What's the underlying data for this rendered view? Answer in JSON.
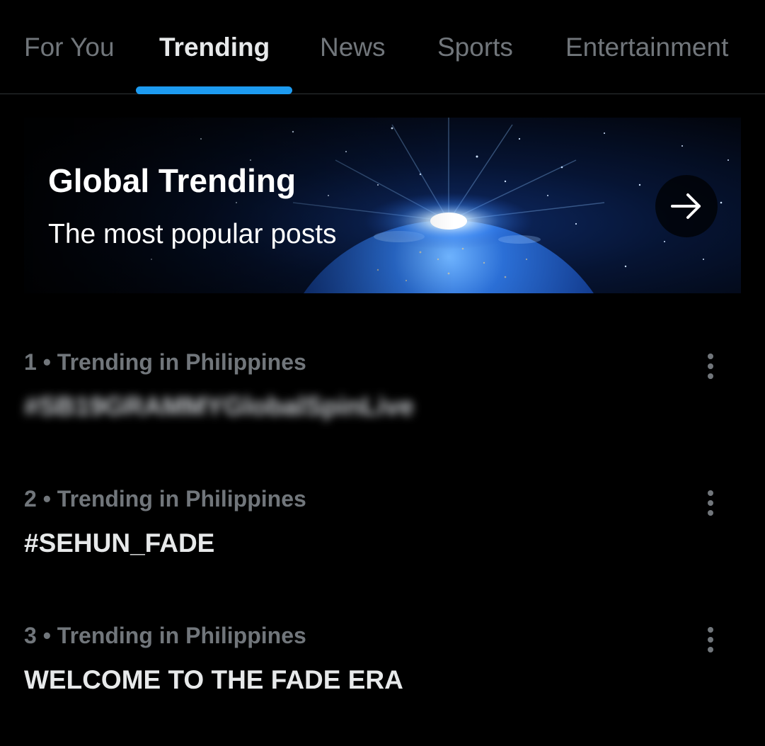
{
  "tabs": [
    {
      "label": "For You"
    },
    {
      "label": "Trending"
    },
    {
      "label": "News"
    },
    {
      "label": "Sports"
    },
    {
      "label": "Entertainment"
    }
  ],
  "active_tab": "Trending",
  "banner": {
    "title": "Global Trending",
    "subtitle": "The most popular posts",
    "arrow_icon": "arrow-right-icon"
  },
  "trends": [
    {
      "meta": "1 • Trending in Philippines",
      "name": "#SB19GRAMMYGlobalSpinLive",
      "blurred": true
    },
    {
      "meta": "2 • Trending in Philippines",
      "name": "#SEHUN_FADE",
      "blurred": false
    },
    {
      "meta": "3 • Trending in Philippines",
      "name": "WELCOME TO THE FADE ERA",
      "blurred": false
    }
  ],
  "colors": {
    "accent": "#1d9bf0",
    "background": "#000000",
    "text_primary": "#e7e9ea",
    "text_secondary": "#71767b"
  }
}
